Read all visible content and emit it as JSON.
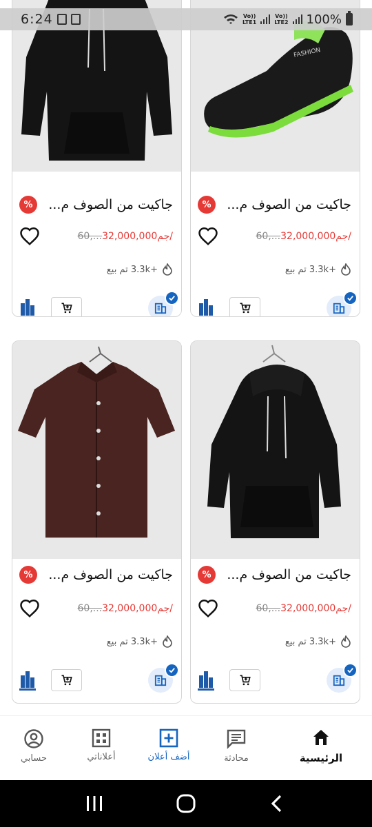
{
  "status": {
    "time": "6:24",
    "battery": "100%",
    "sim1": "LTE1",
    "sim2": "LTE2",
    "volte": "Vo))"
  },
  "products": [
    {
      "title": "جاكيت من الصوف م...",
      "price": "32,000,000جم/",
      "old_price": "60,...",
      "sold": "+3.3k تم بيع",
      "discount_icon": "percent-badge-icon",
      "image": "black-hoodie",
      "verified": true
    },
    {
      "title": "جاكيت من الصوف م...",
      "price": "32,000,000جم/",
      "old_price": "60,...",
      "sold": "+3.3k تم بيع",
      "discount_icon": "percent-badge-icon",
      "image": "black-green-sneaker",
      "verified": true
    },
    {
      "title": "جاكيت من الصوف م...",
      "price": "32,000,000جم/",
      "old_price": "60,...",
      "sold": "+3.3k تم بيع",
      "discount_icon": "percent-badge-icon",
      "image": "brown-shirt",
      "verified": true
    },
    {
      "title": "جاكيت من الصوف م...",
      "price": "32,000,000جم/",
      "old_price": "60,...",
      "sold": "+3.3k تم بيع",
      "discount_icon": "percent-badge-icon",
      "image": "black-hoodie-hanger",
      "verified": true
    }
  ],
  "bottom_nav": {
    "account": "حسابي",
    "my_ads": "أعلاناتي",
    "add_ad": "أضف أعلان",
    "chat": "محادثة",
    "home": "الرئيسية"
  },
  "colors": {
    "accent": "#1565c0",
    "price": "#e53935",
    "discount": "#e53935"
  }
}
